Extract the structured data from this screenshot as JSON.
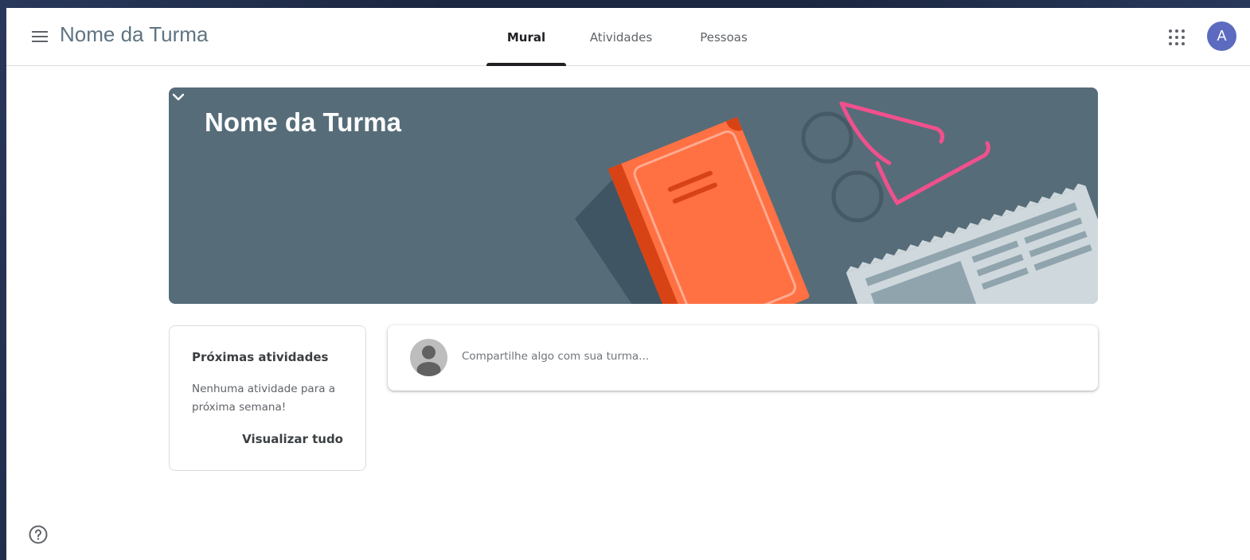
{
  "header": {
    "title": "Nome da Turma",
    "tabs": [
      {
        "label": "Mural",
        "active": true
      },
      {
        "label": "Atividades",
        "active": false
      },
      {
        "label": "Pessoas",
        "active": false
      }
    ],
    "avatar_letter": "A"
  },
  "banner": {
    "title": "Nome da Turma"
  },
  "upcoming": {
    "title": "Próximas atividades",
    "empty_text": "Nenhuma atividade para a próxima semana!",
    "view_all_label": "Visualizar tudo"
  },
  "share": {
    "placeholder": "Compartilhe algo com sua turma..."
  },
  "colors": {
    "banner_bg": "#566c79",
    "avatar_bg": "#5c6bc0",
    "book": "#ff7043",
    "glasses": "#f0508c"
  },
  "icons": [
    "menu-icon",
    "apps-grid-icon",
    "chevron-down-icon",
    "user-placeholder-icon",
    "help-icon"
  ]
}
